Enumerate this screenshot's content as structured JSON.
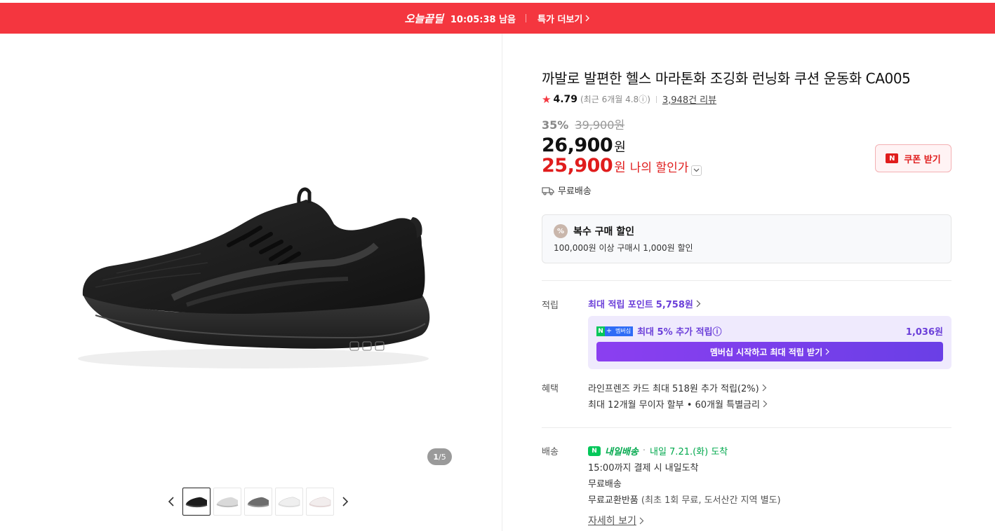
{
  "banner": {
    "logo": "오늘끝딜",
    "timer": "10:05:38 남음",
    "more_label": "특가 더보기"
  },
  "gallery": {
    "page_current": "1",
    "page_separator": "/",
    "page_total": "5",
    "thumbnails": [
      "black",
      "light-gray",
      "dark-gray",
      "white",
      "white-pink"
    ],
    "selected_thumbnail": 0
  },
  "product": {
    "title": "까발로 발편한 헬스 마라톤화 조깅화 런닝화 쿠션 운동화 CA005",
    "rating": "4.79",
    "recent_rating": "(최근 6개월 4.8ⓘ)",
    "review_count": "3,948건 리뷰",
    "discount_rate": "35%",
    "original_price": "39,900원",
    "price": "26,900",
    "price_unit": "원",
    "my_price": "25,900",
    "my_price_unit": "원",
    "my_price_label": "나의 할인가",
    "coupon_label": "쿠폰 받기",
    "coupon_logo": "N",
    "shipping": "무료배송"
  },
  "multi_discount": {
    "icon": "%",
    "title": "복수 구매 할인",
    "desc": "100,000원 이상 구매시 1,000원 할인"
  },
  "points": {
    "label": "적립",
    "max_label": "최대 적립 포인트",
    "max_value": "5,758원",
    "badge_n": "N",
    "badge_plus": "+",
    "badge_member": "멤버십",
    "member_text": "최대 5% 추가 적립ⓘ",
    "member_amount": "1,036원",
    "cta": "멤버십 시작하고 최대 적립 받기"
  },
  "benefits": {
    "label": "혜택",
    "lines": [
      "라인프렌즈 카드 최대 518원 추가 적립(2%)",
      "최대 12개월 무이자 할부 • 60개월 특별금리"
    ]
  },
  "delivery": {
    "label": "배송",
    "badge": "N",
    "brand": "내일배송",
    "dot": "·",
    "eta": "내일 7.21.(화) 도착",
    "lines": [
      "15:00까지 결제 시 내일도착",
      "무료배송"
    ],
    "exchange": "무료교환반품",
    "exchange_note": "(최초 1회 무료, 도서산간 지역 별도)",
    "detail_link": "자세히 보기"
  },
  "colors": {
    "banner": "#f4363f",
    "sale_red": "#e01d1d",
    "purple": "#6b3fd9",
    "naver_green": "#03c75a"
  }
}
